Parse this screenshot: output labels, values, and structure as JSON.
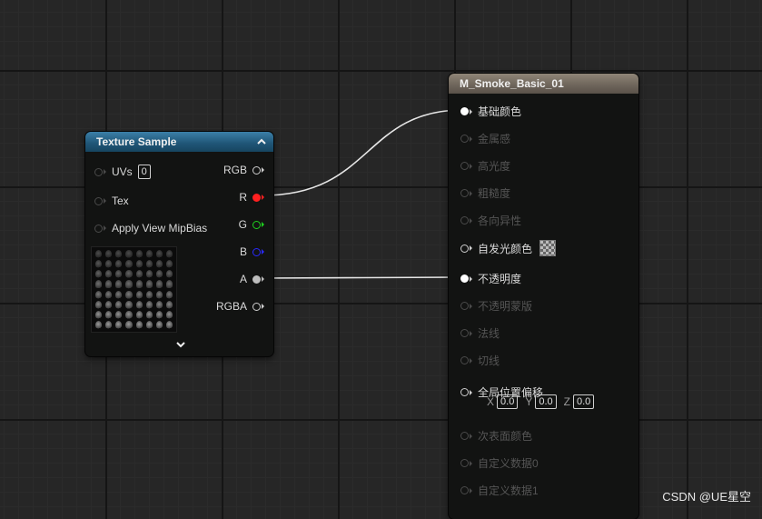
{
  "texture_node": {
    "title": "Texture Sample",
    "inputs": [
      {
        "label": "UVs",
        "value": "0"
      },
      {
        "label": "Tex"
      },
      {
        "label": "Apply View MipBias"
      }
    ],
    "outputs": [
      {
        "label": "RGB",
        "color": "#cfcfcf",
        "filled": false
      },
      {
        "label": "R",
        "color": "#ff2020",
        "filled": true
      },
      {
        "label": "G",
        "color": "#1ed01e",
        "filled": false
      },
      {
        "label": "B",
        "color": "#2a2aff",
        "filled": false
      },
      {
        "label": "A",
        "color": "#bdbdbd",
        "filled": true
      },
      {
        "label": "RGBA",
        "color": "#cfcfcf",
        "filled": false
      }
    ]
  },
  "material_node": {
    "title": "M_Smoke_Basic_01",
    "pins": [
      {
        "label": "基础颜色",
        "active": true,
        "filled": true
      },
      {
        "label": "金属感",
        "active": false
      },
      {
        "label": "高光度",
        "active": false
      },
      {
        "label": "粗糙度",
        "active": false
      },
      {
        "label": "各向异性",
        "active": false
      },
      {
        "label": "自发光颜色",
        "active": true,
        "filled": false,
        "swatch": true
      },
      {
        "label": "不透明度",
        "active": true,
        "filled": true
      },
      {
        "label": "不透明蒙版",
        "active": false
      },
      {
        "label": "法线",
        "active": false
      },
      {
        "label": "切线",
        "active": false
      },
      {
        "label": "全局位置偏移",
        "active": true,
        "filled": false
      },
      {
        "label": "次表面颜色",
        "active": false
      },
      {
        "label": "自定义数据0",
        "active": false
      },
      {
        "label": "自定义数据1",
        "active": false
      }
    ],
    "world_offset": {
      "x_label": "X",
      "x": "0.0",
      "y_label": "Y",
      "y": "0.0",
      "z_label": "Z",
      "z": "0.0"
    }
  },
  "watermark": "CSDN @UE星空"
}
